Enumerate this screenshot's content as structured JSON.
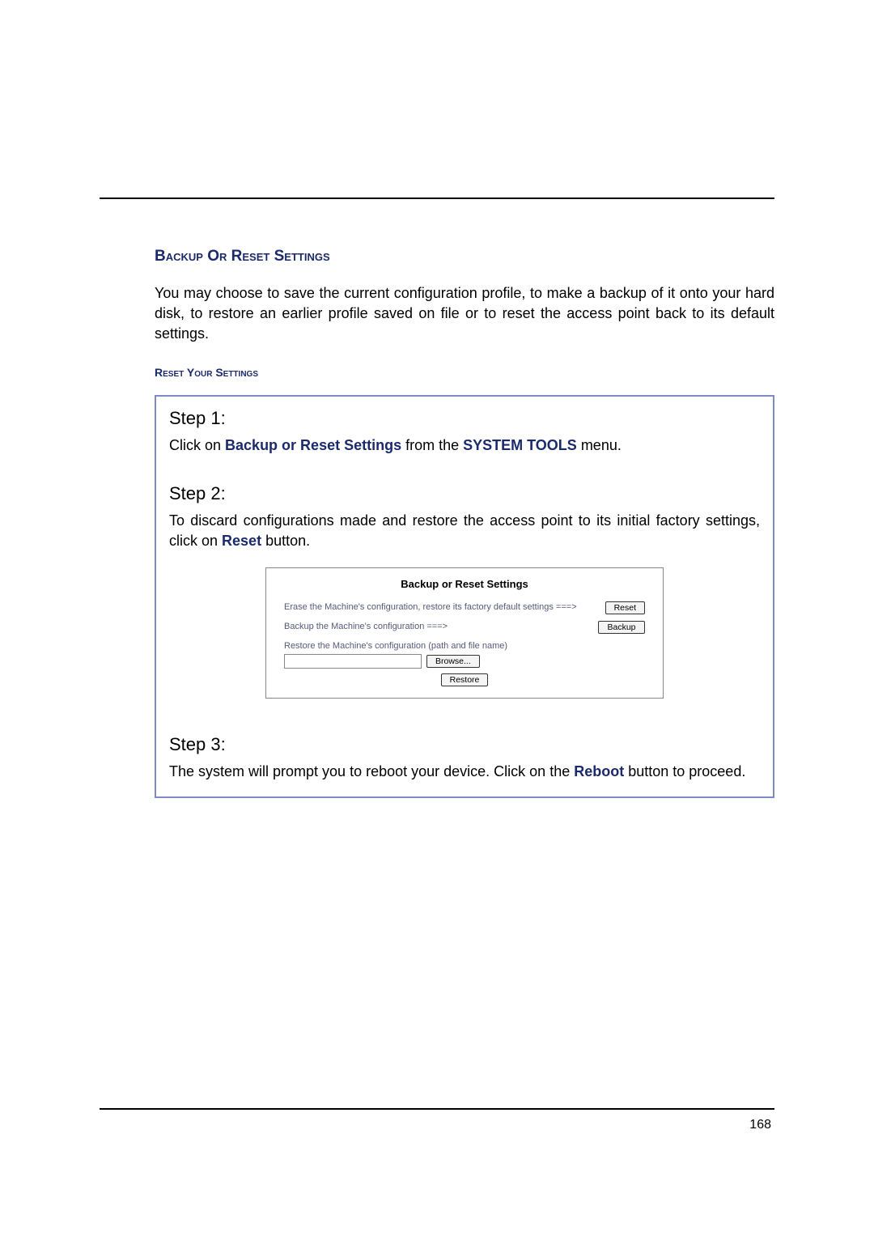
{
  "page": {
    "number": "168"
  },
  "headings": {
    "main": "Backup Or Reset Settings",
    "sub": "Reset Your Settings"
  },
  "intro": "You may choose to save the current configuration profile, to make a backup of it onto your hard disk, to restore an earlier profile saved on file or to reset the access point back to its default settings.",
  "steps": {
    "s1": {
      "title": "Step 1:",
      "pre": "Click on ",
      "kw1": "Backup or Reset Settings",
      "mid": " from the ",
      "kw2": "SYSTEM TOOLS",
      "post": " menu."
    },
    "s2": {
      "title": "Step 2:",
      "pre": "To discard configurations made and restore the access point to its initial factory settings, click on ",
      "kw": "Reset",
      "post": " button."
    },
    "s3": {
      "title": "Step 3:",
      "pre": "The system will prompt you to reboot your device. Click on the ",
      "kw": "Reboot",
      "post": " button to proceed."
    }
  },
  "figure": {
    "title": "Backup or Reset Settings",
    "erase_label": "Erase the Machine's configuration, restore its factory default settings ===>",
    "backup_label": "Backup the Machine's configuration ===>",
    "restore_label": "Restore the Machine's configuration (path and file name)",
    "buttons": {
      "reset": "Reset",
      "backup": "Backup",
      "browse": "Browse...",
      "restore": "Restore"
    },
    "file_value": ""
  }
}
